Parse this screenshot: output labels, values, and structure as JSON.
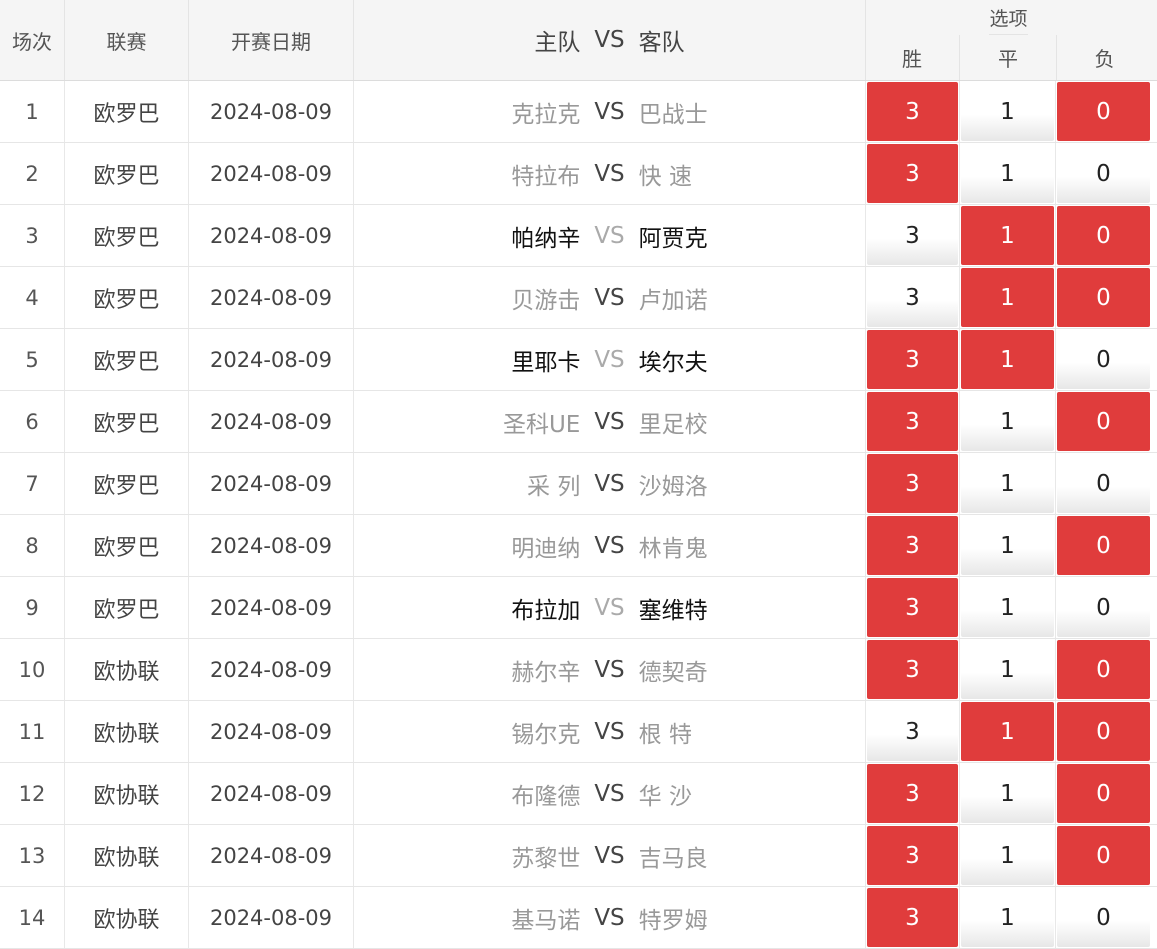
{
  "header": {
    "num": "场次",
    "league": "联赛",
    "date": "开赛日期",
    "home": "主队",
    "vs": "VS",
    "away": "客队",
    "options_title": "选项",
    "win": "胜",
    "draw": "平",
    "lose": "负"
  },
  "rows": [
    {
      "num": "1",
      "league": "欧罗巴",
      "date": "2024-08-09",
      "home": "克拉克",
      "vs": "VS",
      "away": "巴战士",
      "style": "muted",
      "w": "3",
      "d": "1",
      "l": "0",
      "sel": [
        true,
        false,
        true
      ]
    },
    {
      "num": "2",
      "league": "欧罗巴",
      "date": "2024-08-09",
      "home": "特拉布",
      "vs": "VS",
      "away": "快 速",
      "style": "muted",
      "w": "3",
      "d": "1",
      "l": "0",
      "sel": [
        true,
        false,
        false
      ]
    },
    {
      "num": "3",
      "league": "欧罗巴",
      "date": "2024-08-09",
      "home": "帕纳辛",
      "vs": "VS",
      "away": "阿贾克",
      "style": "strong",
      "w": "3",
      "d": "1",
      "l": "0",
      "sel": [
        false,
        true,
        true
      ]
    },
    {
      "num": "4",
      "league": "欧罗巴",
      "date": "2024-08-09",
      "home": "贝游击",
      "vs": "VS",
      "away": "卢加诺",
      "style": "muted",
      "w": "3",
      "d": "1",
      "l": "0",
      "sel": [
        false,
        true,
        true
      ]
    },
    {
      "num": "5",
      "league": "欧罗巴",
      "date": "2024-08-09",
      "home": "里耶卡",
      "vs": "VS",
      "away": "埃尔夫",
      "style": "strong",
      "w": "3",
      "d": "1",
      "l": "0",
      "sel": [
        true,
        true,
        false
      ]
    },
    {
      "num": "6",
      "league": "欧罗巴",
      "date": "2024-08-09",
      "home": "圣科UE",
      "vs": "VS",
      "away": "里足校",
      "style": "muted",
      "w": "3",
      "d": "1",
      "l": "0",
      "sel": [
        true,
        false,
        true
      ]
    },
    {
      "num": "7",
      "league": "欧罗巴",
      "date": "2024-08-09",
      "home": "采 列",
      "vs": "VS",
      "away": "沙姆洛",
      "style": "muted",
      "w": "3",
      "d": "1",
      "l": "0",
      "sel": [
        true,
        false,
        false
      ]
    },
    {
      "num": "8",
      "league": "欧罗巴",
      "date": "2024-08-09",
      "home": "明迪纳",
      "vs": "VS",
      "away": "林肯鬼",
      "style": "muted",
      "w": "3",
      "d": "1",
      "l": "0",
      "sel": [
        true,
        false,
        true
      ]
    },
    {
      "num": "9",
      "league": "欧罗巴",
      "date": "2024-08-09",
      "home": "布拉加",
      "vs": "VS",
      "away": "塞维特",
      "style": "strong",
      "w": "3",
      "d": "1",
      "l": "0",
      "sel": [
        true,
        false,
        false
      ]
    },
    {
      "num": "10",
      "league": "欧协联",
      "date": "2024-08-09",
      "home": "赫尔辛",
      "vs": "VS",
      "away": "德契奇",
      "style": "muted",
      "w": "3",
      "d": "1",
      "l": "0",
      "sel": [
        true,
        false,
        true
      ]
    },
    {
      "num": "11",
      "league": "欧协联",
      "date": "2024-08-09",
      "home": "锡尔克",
      "vs": "VS",
      "away": "根 特",
      "style": "muted",
      "w": "3",
      "d": "1",
      "l": "0",
      "sel": [
        false,
        true,
        true
      ]
    },
    {
      "num": "12",
      "league": "欧协联",
      "date": "2024-08-09",
      "home": "布隆德",
      "vs": "VS",
      "away": "华 沙",
      "style": "muted",
      "w": "3",
      "d": "1",
      "l": "0",
      "sel": [
        true,
        false,
        true
      ]
    },
    {
      "num": "13",
      "league": "欧协联",
      "date": "2024-08-09",
      "home": "苏黎世",
      "vs": "VS",
      "away": "吉马良",
      "style": "muted",
      "w": "3",
      "d": "1",
      "l": "0",
      "sel": [
        true,
        false,
        true
      ]
    },
    {
      "num": "14",
      "league": "欧协联",
      "date": "2024-08-09",
      "home": "基马诺",
      "vs": "VS",
      "away": "特罗姆",
      "style": "muted",
      "w": "3",
      "d": "1",
      "l": "0",
      "sel": [
        true,
        false,
        false
      ]
    }
  ],
  "colors": {
    "selected": "#e03c3c",
    "muted_text": "#999999"
  }
}
